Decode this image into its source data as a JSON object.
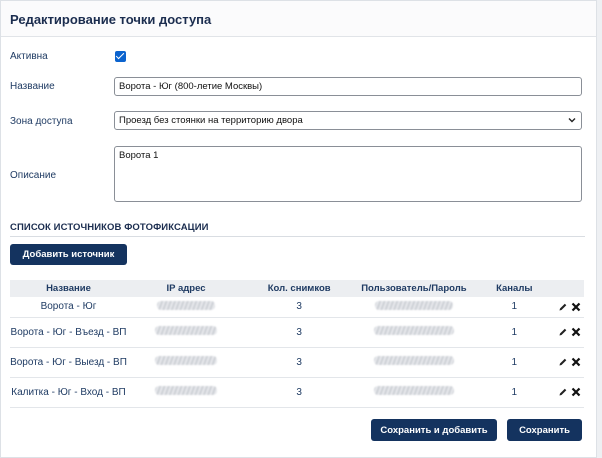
{
  "header": {
    "title": "Редактирование точки доступа"
  },
  "form": {
    "active_label": "Активна",
    "active_checked": true,
    "name_label": "Название",
    "name_value": "Ворота - Юг (800-летие Москвы)",
    "zone_label": "Зона доступа",
    "zone_value": "Проезд без стоянки на территорию двора",
    "description_label": "Описание",
    "description_value": "Ворота 1"
  },
  "sources": {
    "section_title": "СПИСОК ИСТОЧНИКОВ ФОТОФИКСАЦИИ",
    "add_button": "Добавить источник",
    "columns": [
      "Название",
      "IP адрес",
      "Кол. снимков",
      "Пользователь/Пароль",
      "Каналы"
    ],
    "rows": [
      {
        "name": "Ворота - Юг",
        "shots": "3",
        "channels": "1"
      },
      {
        "name": "Ворота - Юг - Въезд - ВП",
        "shots": "3",
        "channels": "1"
      },
      {
        "name": "Ворота - Юг - Выезд - ВП",
        "shots": "3",
        "channels": "1"
      },
      {
        "name": "Калитка - Юг - Вход - ВП",
        "shots": "3",
        "channels": "1"
      }
    ]
  },
  "footer": {
    "save_and_add": "Сохранить и добавить",
    "save": "Сохранить"
  },
  "colors": {
    "primary": "#14335f",
    "checkbox": "#0b63ce",
    "text": "#1f3b63"
  }
}
